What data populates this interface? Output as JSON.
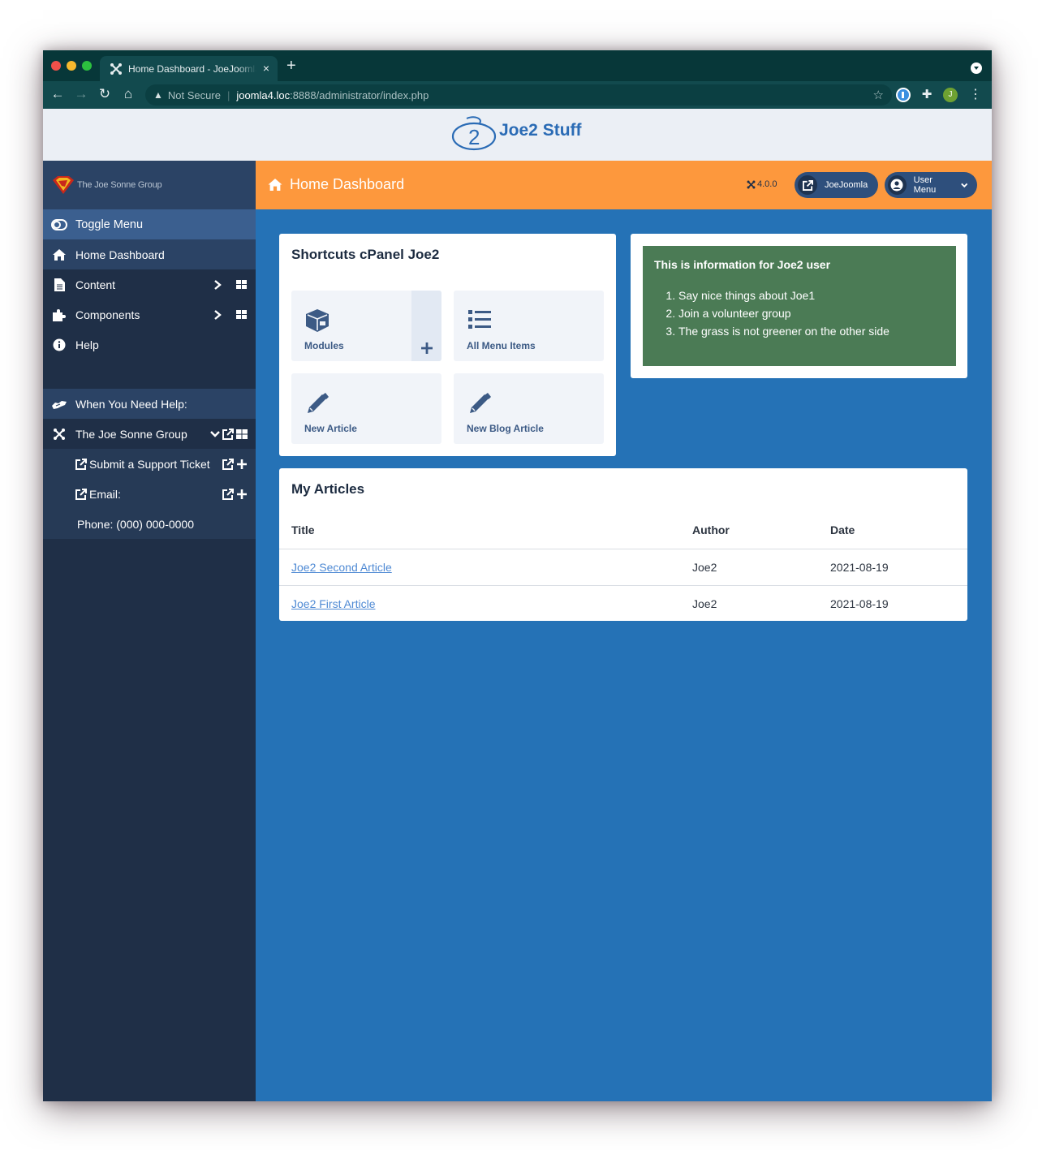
{
  "browser": {
    "tab_title": "Home Dashboard - JoeJoomla",
    "tab_close": "×",
    "new_tab": "+",
    "security": "Not Secure",
    "url_host": "joomla4.loc",
    "url_rest": ":8888/administrator/index.php",
    "profile_initial": "J"
  },
  "site": {
    "name": "Joe2 Stuff"
  },
  "sidebar": {
    "logo_text": "The Joe Sonne Group",
    "items": [
      {
        "label": "Toggle Menu"
      },
      {
        "label": "Home Dashboard"
      },
      {
        "label": "Content"
      },
      {
        "label": "Components"
      },
      {
        "label": "Help"
      }
    ],
    "help_heading": "When You Need Help:",
    "group_label": "The Joe Sonne Group",
    "sub_items": [
      {
        "label": "Submit a Support Ticket"
      },
      {
        "label": "Email:"
      },
      {
        "label": "Phone: (000) 000-0000"
      }
    ]
  },
  "header": {
    "title": "Home Dashboard",
    "version": "4.0.0",
    "site_button": "JoeJoomla",
    "user_menu": "User Menu"
  },
  "shortcuts": {
    "title": "Shortcuts cPanel Joe2",
    "items": [
      {
        "label": "Modules",
        "icon": "cube-icon"
      },
      {
        "label": "All Menu Items",
        "icon": "list-icon"
      },
      {
        "label": "New Article",
        "icon": "pencil-icon"
      },
      {
        "label": "New Blog Article",
        "icon": "pencil-icon"
      }
    ]
  },
  "info": {
    "title": "This is information for Joe2 user",
    "items": [
      "Say nice things about Joe1",
      "Join a volunteer group",
      "The grass is not greener on the other side"
    ],
    "background": "#4b7b55"
  },
  "articles": {
    "title": "My Articles",
    "columns": [
      "Title",
      "Author",
      "Date"
    ],
    "rows": [
      {
        "title": "Joe2 Second Article",
        "author": "Joe2",
        "date": "2021-08-19"
      },
      {
        "title": "Joe2 First Article",
        "author": "Joe2",
        "date": "2021-08-19"
      }
    ]
  },
  "colors": {
    "header_accent": "#fd983d",
    "sidebar": "#1f2f47",
    "main_bg": "#2572b6",
    "link": "#4f8ad4"
  }
}
